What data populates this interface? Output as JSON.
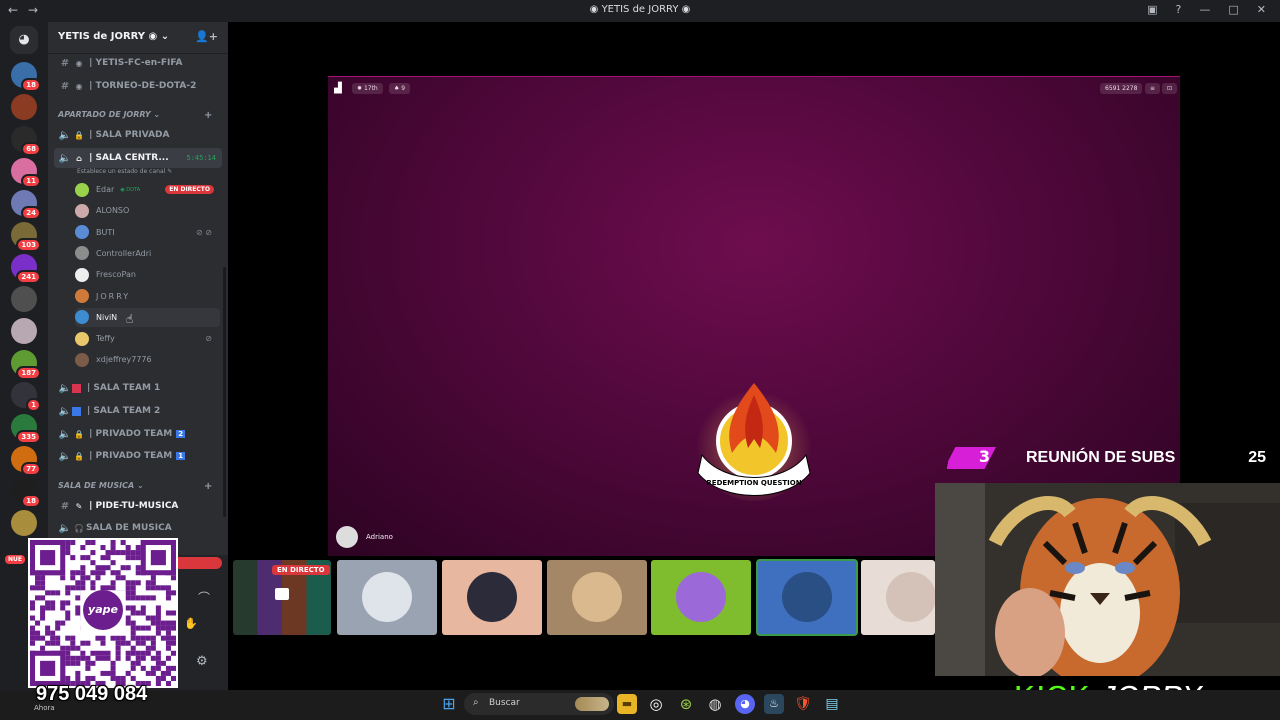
{
  "window": {
    "title": "YETIS de JORRY"
  },
  "server": {
    "name": "YETIS de JORRY"
  },
  "rail_servers": [
    {
      "badge": "18",
      "color": "#3a6ea8"
    },
    {
      "badge": "",
      "color": "#8a3b21"
    },
    {
      "badge": "68",
      "color": "#2a2a2a"
    },
    {
      "badge": "11",
      "color": "#d86fa0"
    },
    {
      "badge": "24",
      "color": "#6e7ab4"
    },
    {
      "badge": "103",
      "color": "#7a6a38"
    },
    {
      "badge": "241",
      "color": "#7a2fc9"
    },
    {
      "badge": "",
      "color": "#4f4f4f"
    },
    {
      "badge": "",
      "color": "#b8a8b2"
    },
    {
      "badge": "187",
      "color": "#5e9c33"
    },
    {
      "badge": "1",
      "color": "#33333b"
    },
    {
      "badge": "335",
      "color": "#2b7a3d"
    },
    {
      "badge": "77",
      "color": "#d06d10"
    },
    {
      "badge": "18",
      "color": "#1e1e1e"
    },
    {
      "badge": "",
      "color": "#a88e3c"
    }
  ],
  "channels_top": [
    {
      "name": "| YETIS-FC-en-FIFA"
    },
    {
      "name": "| TORNEO-DE-DOTA-2"
    }
  ],
  "category1": {
    "name": "APARTADO DE JORRY"
  },
  "voice": {
    "private": "| SALA PRIVADA",
    "central": "| SALA CENTR...",
    "central_time": "5:45:14",
    "status_hint": "Establece un estado de canal",
    "team1": "| SALA TEAM 1",
    "team2": "| SALA TEAM 2",
    "private_team2": "| PRIVADO TEAM",
    "private_team2_num": "2",
    "private_team1": "| PRIVADO TEAM",
    "private_team1_num": "1"
  },
  "voice_users": [
    {
      "name": "Edar",
      "extra": "DOTA",
      "live": "EN DIRECTO",
      "color": "#9ad14b"
    },
    {
      "name": "ALONSO",
      "extra": "",
      "live": "",
      "color": "#caa"
    },
    {
      "name": "BUTI",
      "extra": "",
      "live": "",
      "color": "#5c8bd6"
    },
    {
      "name": "ControllerAdri",
      "extra": "",
      "live": "",
      "color": "#8c8c8c"
    },
    {
      "name": "FrescoPan",
      "extra": "",
      "live": "",
      "color": "#eeeeee"
    },
    {
      "name": "JORRY",
      "extra": "",
      "live": "",
      "color": "#d07a3a"
    },
    {
      "name": "NiviN",
      "extra": "",
      "live": "",
      "color": "#3d8bd0"
    },
    {
      "name": "Teffy",
      "extra": "",
      "live": "",
      "color": "#e9c76b"
    },
    {
      "name": "xdjeffrey7776",
      "extra": "",
      "live": "",
      "color": "#7a5c48"
    }
  ],
  "category2": {
    "name": "SALA DE MUSICA"
  },
  "music_channels": [
    {
      "name": "| PIDE-TU-MUSICA"
    },
    {
      "name": "SALA DE MUSICA"
    }
  ],
  "panel": {
    "new_badge": "NUE",
    "now": "Ahora"
  },
  "qr": {
    "phone": "975 049 084",
    "brand": "yape"
  },
  "stream": {
    "rank": "17th",
    "viewers": "9",
    "stat": "6591 2278",
    "streamer": "Adriano",
    "logo_text": "REDEMPTION QUESTION"
  },
  "tiles": {
    "live_label": "EN DIRECTO"
  },
  "overlay": {
    "subs_count": "3",
    "subs_label": "REUNIÓN DE SUBS",
    "subs_goal": "25",
    "kick": "KICK",
    "channel": "JORRY"
  },
  "taskbar": {
    "search_placeholder": "Buscar"
  }
}
